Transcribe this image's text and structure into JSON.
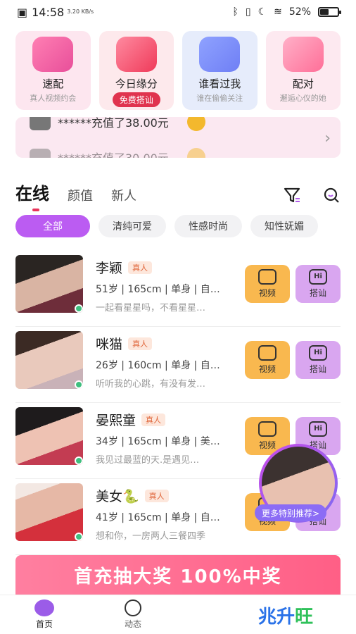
{
  "status_bar": {
    "time": "14:58",
    "speed": "3.20 KB/s",
    "battery": "52%",
    "battery_level": 0.52
  },
  "features": [
    {
      "title": "速配",
      "subtitle": "真人视频约会",
      "badge": ""
    },
    {
      "title": "今日缘分",
      "subtitle": "",
      "badge": "免费搭讪"
    },
    {
      "title": "谁看过我",
      "subtitle": "谁在偷偷关注",
      "badge": ""
    },
    {
      "title": "配对",
      "subtitle": "邂逅心仪的她",
      "badge": ""
    }
  ],
  "ticker": {
    "row1": "******充值了38.00元",
    "row2": "******充值了30.00元"
  },
  "tabs": [
    {
      "label": "在线"
    },
    {
      "label": "颜值"
    },
    {
      "label": "新人"
    }
  ],
  "chips": [
    {
      "label": "全部"
    },
    {
      "label": "清纯可爱"
    },
    {
      "label": "性感时尚"
    },
    {
      "label": "知性妩媚"
    }
  ],
  "users": [
    {
      "name": "李颖",
      "badge": "真人",
      "info": "51岁 | 165cm | 单身 | 自…",
      "bio": "一起看星星吗，不看星星…",
      "video": "视频",
      "chat": "搭讪"
    },
    {
      "name": "咪猫",
      "badge": "真人",
      "info": "26岁 | 160cm | 单身 | 自…",
      "bio": "听听我的心跳，有没有发…",
      "video": "视频",
      "chat": "搭讪"
    },
    {
      "name": "晏熙童",
      "badge": "真人",
      "info": "34岁 | 165cm | 单身 | 美…",
      "bio": "我见过最蓝的天.是遇见…",
      "video": "视频",
      "chat": "搭讪"
    },
    {
      "name": "美女🐍",
      "badge": "真人",
      "info": "41岁 | 165cm | 单身 | 自…",
      "bio": "想和你，一房两人三餐四季",
      "video": "视频",
      "chat": "搭讪"
    }
  ],
  "recommend": "更多特别推荐>",
  "banner": "首充抽大奖 100%中奖",
  "nav": [
    {
      "label": "首页"
    },
    {
      "label": "动态"
    }
  ],
  "watermark": {
    "part1": "兆升",
    "part2": "旺"
  }
}
